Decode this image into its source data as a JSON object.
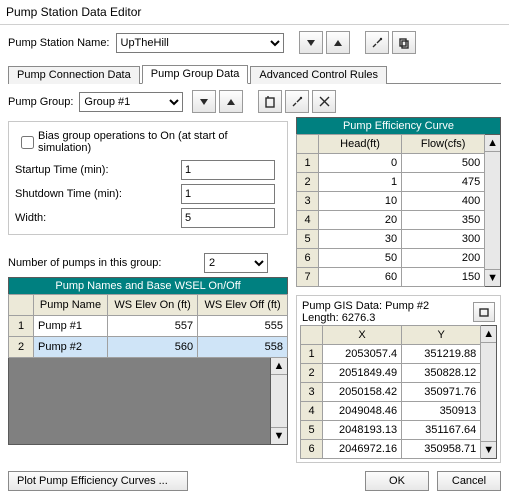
{
  "window": {
    "title": "Pump Station Data Editor"
  },
  "header": {
    "name_label": "Pump Station Name:",
    "name_value": "UpTheHill"
  },
  "tabs": {
    "connection": "Pump Connection Data",
    "group": "Pump Group Data",
    "control": "Advanced Control Rules"
  },
  "group_row": {
    "label": "Pump Group:",
    "value": "Group #1"
  },
  "bias": {
    "label": "Bias group operations to On (at start of simulation)"
  },
  "startup": {
    "label": "Startup Time (min):",
    "value": "1"
  },
  "shutdown": {
    "label": "Shutdown Time (min):",
    "value": "1"
  },
  "width": {
    "label": "Width:",
    "value": "5"
  },
  "num_pumps": {
    "label": "Number of pumps in this group:",
    "value": "2"
  },
  "eff_curve": {
    "title": "Pump Efficiency Curve",
    "head_col": "Head(ft)",
    "flow_col": "Flow(cfs)",
    "rows": [
      {
        "i": "1",
        "head": "0",
        "flow": "500"
      },
      {
        "i": "2",
        "head": "1",
        "flow": "475"
      },
      {
        "i": "3",
        "head": "10",
        "flow": "400"
      },
      {
        "i": "4",
        "head": "20",
        "flow": "350"
      },
      {
        "i": "5",
        "head": "30",
        "flow": "300"
      },
      {
        "i": "6",
        "head": "50",
        "flow": "200"
      },
      {
        "i": "7",
        "head": "60",
        "flow": "150"
      }
    ]
  },
  "pump_names": {
    "title": "Pump Names and Base WSEL On/Off",
    "cols": {
      "name": "Pump Name",
      "on": "WS Elev On (ft)",
      "off": "WS Elev Off (ft)"
    },
    "rows": [
      {
        "i": "1",
        "name": "Pump #1",
        "on": "557",
        "off": "555"
      },
      {
        "i": "2",
        "name": "Pump #2",
        "on": "560",
        "off": "558"
      }
    ]
  },
  "gis": {
    "head1": "Pump GIS Data: Pump #2",
    "head2": "Length: 6276.3",
    "cols": {
      "x": "X",
      "y": "Y"
    },
    "rows": [
      {
        "i": "1",
        "x": "2053057.4",
        "y": "351219.88"
      },
      {
        "i": "2",
        "x": "2051849.49",
        "y": "350828.12"
      },
      {
        "i": "3",
        "x": "2050158.42",
        "y": "350971.76"
      },
      {
        "i": "4",
        "x": "2049048.46",
        "y": "350913"
      },
      {
        "i": "5",
        "x": "2048193.13",
        "y": "351167.64"
      },
      {
        "i": "6",
        "x": "2046972.16",
        "y": "350958.71"
      }
    ]
  },
  "buttons": {
    "plot": "Plot Pump Efficiency Curves ...",
    "ok": "OK",
    "cancel": "Cancel"
  }
}
